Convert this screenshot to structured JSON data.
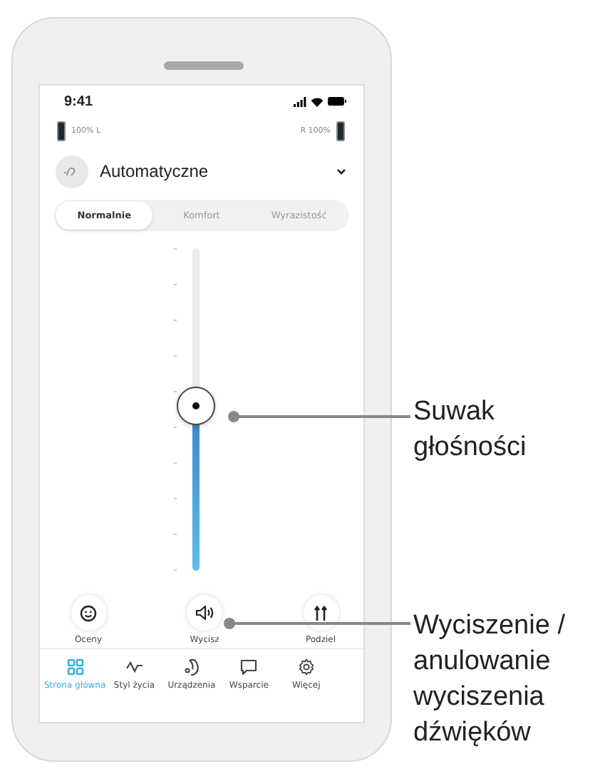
{
  "status_bar": {
    "time": "9:41"
  },
  "battery": {
    "left": "100% L",
    "right": "R 100%"
  },
  "program": {
    "name": "Automatyczne"
  },
  "tabs": [
    {
      "label": "Normalnie",
      "selected": true
    },
    {
      "label": "Komfort",
      "selected": false
    },
    {
      "label": "Wyrazistość",
      "selected": false
    }
  ],
  "volume_slider": {
    "level": 0.51
  },
  "actions": [
    {
      "label": "Oceny",
      "kind": "rate"
    },
    {
      "label": "Wycisz",
      "kind": "mute"
    },
    {
      "label": "Podziel",
      "kind": "split"
    }
  ],
  "nav": [
    {
      "label": "Strona główna",
      "kind": "home",
      "selected": true
    },
    {
      "label": "Styl życia",
      "kind": "lifestyle",
      "selected": false
    },
    {
      "label": "Urządzenia",
      "kind": "devices",
      "selected": false
    },
    {
      "label": "Wsparcie",
      "kind": "support",
      "selected": false
    },
    {
      "label": "Więcej",
      "kind": "more",
      "selected": false
    }
  ],
  "callouts": [
    {
      "text": "Suwak głośności"
    },
    {
      "text": "Wyciszenie / anulowanie wyciszenia dźwięków"
    }
  ]
}
